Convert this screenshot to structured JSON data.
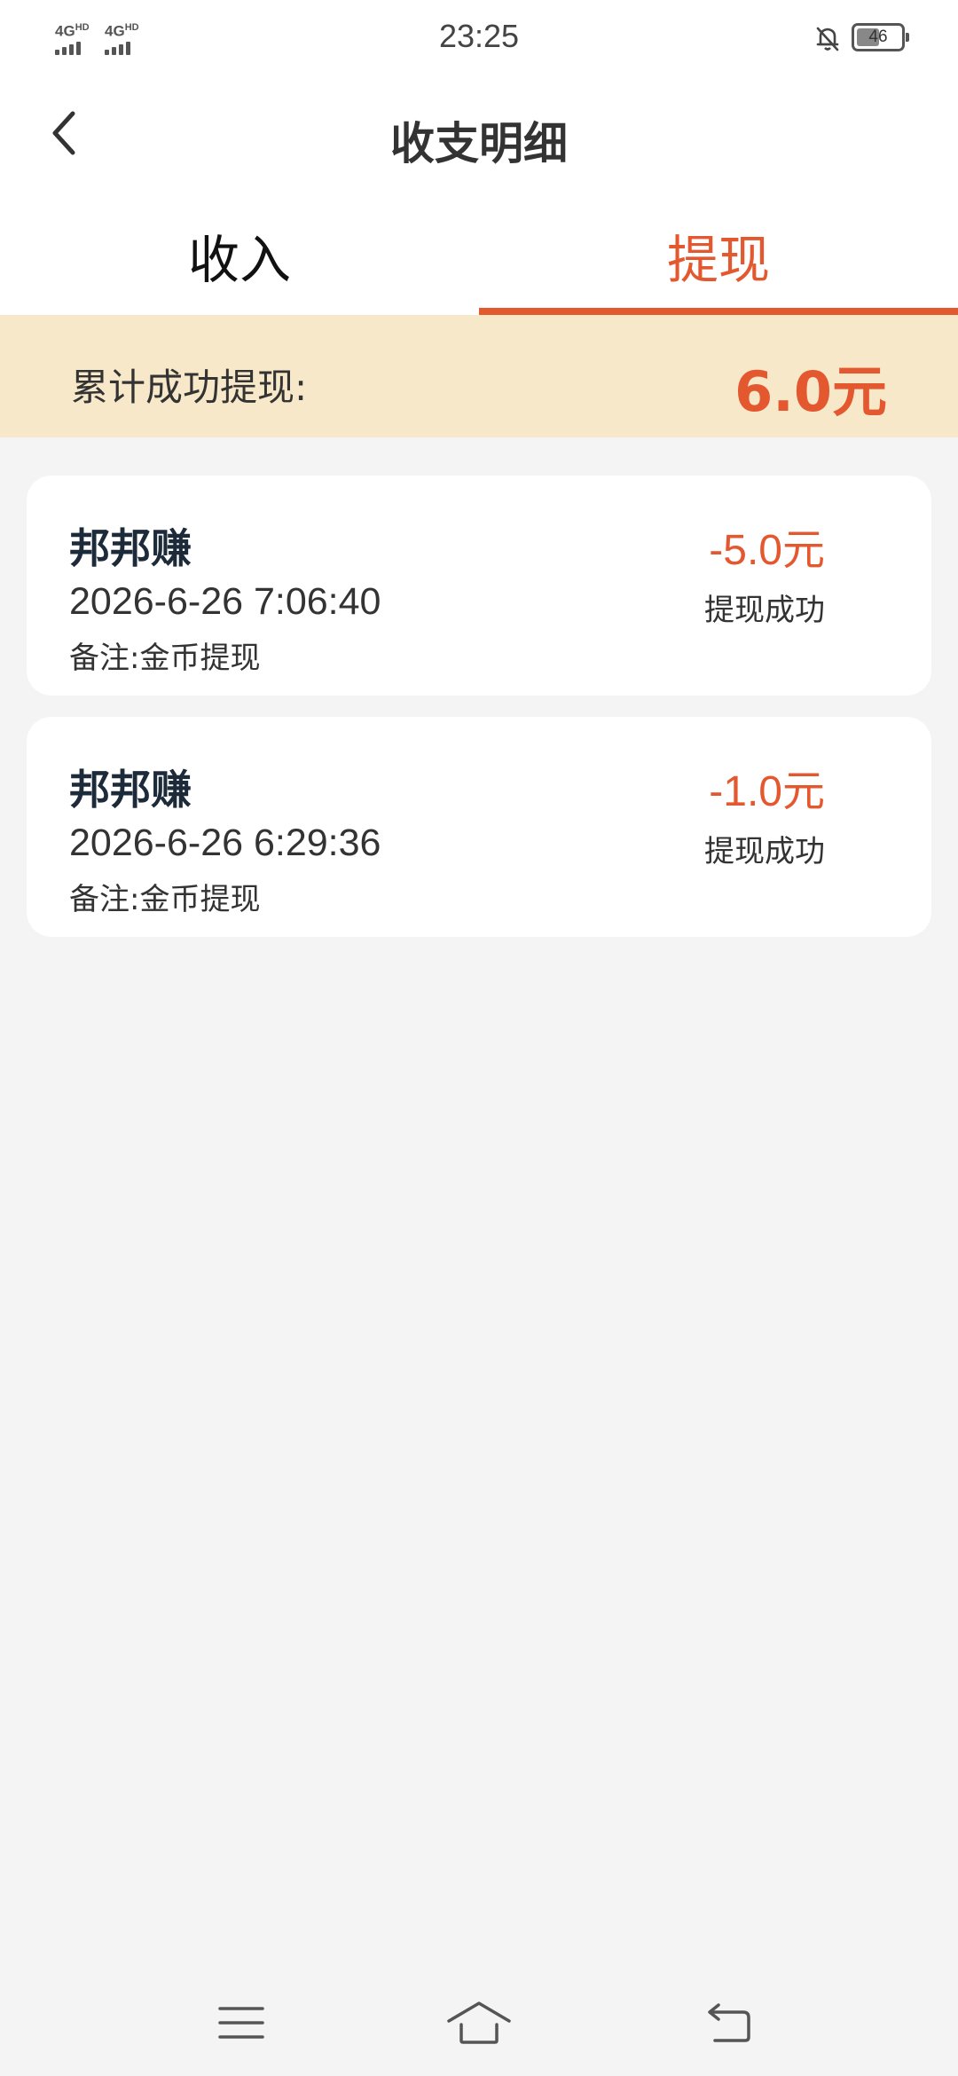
{
  "status_bar": {
    "network_1": "4G",
    "network_1_sup": "HD",
    "network_2": "4G",
    "network_2_sup": "HD",
    "time": "23:25",
    "battery": "46"
  },
  "header": {
    "title": "收支明细"
  },
  "tabs": [
    {
      "label": "收入",
      "active": false
    },
    {
      "label": "提现",
      "active": true
    }
  ],
  "summary": {
    "label": "累计成功提现:",
    "value": "6.0元"
  },
  "records": [
    {
      "title": "邦邦赚",
      "time": "2026-6-26 7:06:40",
      "note": "备注:金币提现",
      "amount": "-5.0元",
      "status": "提现成功"
    },
    {
      "title": "邦邦赚",
      "time": "2026-6-26 6:29:36",
      "note": "备注:金币提现",
      "amount": "-1.0元",
      "status": "提现成功"
    }
  ],
  "colors": {
    "accent": "#e4582f",
    "summary_bg": "#f8e8ca",
    "page_bg": "#f4f4f4"
  },
  "icons": {
    "back": "chevron-left-icon",
    "menu": "menu-icon",
    "home": "home-icon",
    "return": "return-icon",
    "mute": "bell-off-icon"
  }
}
